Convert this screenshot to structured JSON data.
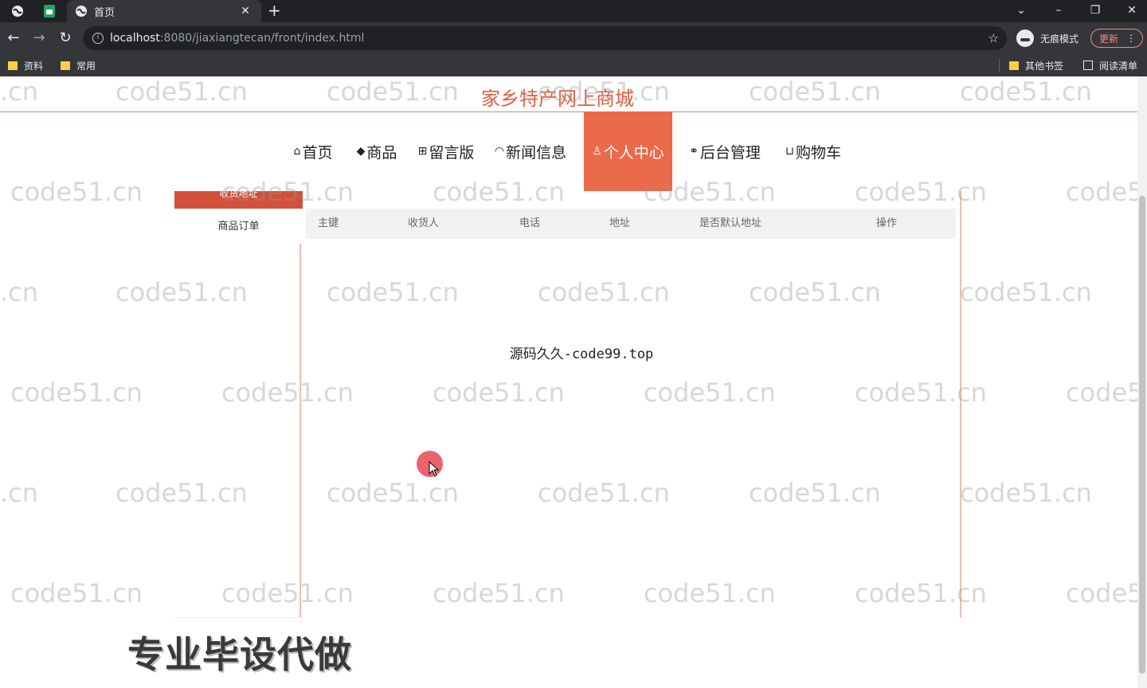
{
  "browser": {
    "tab_title": "首页",
    "url_host": "localhost",
    "url_path": ":8080/jiaxiangtecan/front/index.html",
    "incognito_label": "无痕模式",
    "update_label": "更新",
    "bookmarks": [
      "资料",
      "常用"
    ],
    "bookmarks_right": [
      "其他书签",
      "阅读清单"
    ]
  },
  "site": {
    "title": "家乡特产网上商城"
  },
  "nav": {
    "items": [
      {
        "icon": "⌂",
        "label": "首页"
      },
      {
        "icon": "◆",
        "label": "商品"
      },
      {
        "icon": "⊞",
        "label": "留言版"
      },
      {
        "icon": "◠",
        "label": "新闻信息"
      },
      {
        "icon": "♙",
        "label": "个人中心"
      },
      {
        "icon": "⚭",
        "label": "后台管理"
      },
      {
        "icon": "⊔",
        "label": "购物车"
      }
    ],
    "active_index": 4
  },
  "sidebar": {
    "items": [
      {
        "label": "收货地址"
      },
      {
        "label": "商品订单"
      }
    ]
  },
  "table": {
    "columns": [
      "主键",
      "收货人",
      "电话",
      "地址",
      "是否默认地址",
      "操作"
    ]
  },
  "center_note": "源码久久-code99.top",
  "promo_text": "专业毕设代做",
  "watermark": "code51.cn",
  "colors": {
    "accent": "#ea6a4b",
    "title": "#e0603e",
    "sidebar_active": "#d3513a"
  }
}
